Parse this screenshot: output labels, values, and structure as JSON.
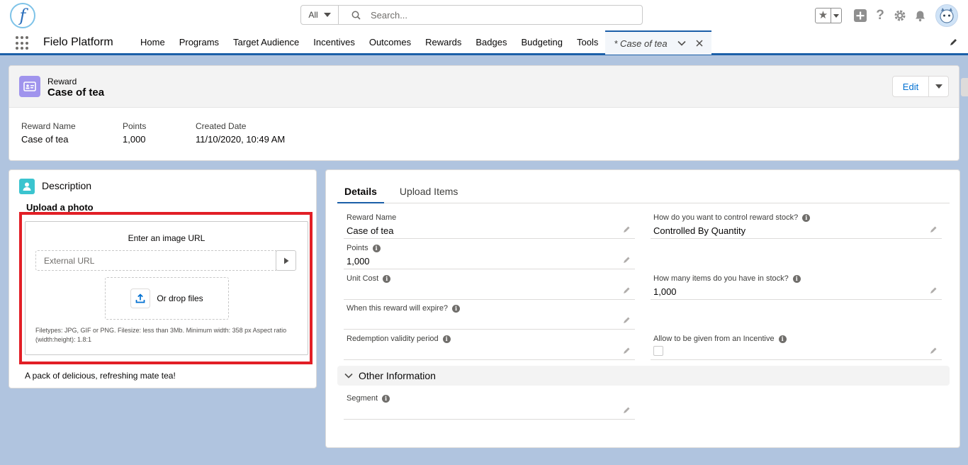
{
  "header": {
    "logo_letter": "f",
    "search_scope": "All",
    "search_placeholder": "Search..."
  },
  "nav": {
    "app_name": "Fielo Platform",
    "items": [
      "Home",
      "Programs",
      "Target Audience",
      "Incentives",
      "Outcomes",
      "Rewards",
      "Badges",
      "Budgeting",
      "Tools"
    ],
    "active_tab": "* Case of tea"
  },
  "record": {
    "type": "Reward",
    "title": "Case of tea",
    "edit_label": "Edit",
    "highlights": [
      {
        "label": "Reward Name",
        "value": "Case of tea"
      },
      {
        "label": "Points",
        "value": "1,000"
      },
      {
        "label": "Created Date",
        "value": "11/10/2020, 10:49 AM"
      }
    ]
  },
  "description_card": {
    "title": "Description",
    "upload_heading": "Upload a photo",
    "url_prompt": "Enter an image URL",
    "url_placeholder": "External URL",
    "drop_label": "Or drop files",
    "hint": "Filetypes: JPG, GIF or PNG. Filesize: less than 3Mb. Minimum width: 358 px Aspect ratio (width:height): 1.8:1",
    "description": "A pack of delicious, refreshing mate tea!"
  },
  "details": {
    "tabs": [
      "Details",
      "Upload Items"
    ],
    "left_fields": [
      {
        "label": "Reward Name",
        "value": "Case of tea",
        "info": false
      },
      {
        "label": "Points",
        "value": "1,000",
        "info": true
      },
      {
        "label": "Unit Cost",
        "value": "",
        "info": true
      },
      {
        "label": "When this reward will expire?",
        "value": "",
        "info": true
      },
      {
        "label": "Redemption validity period",
        "value": "",
        "info": true
      }
    ],
    "right_fields": [
      {
        "label": "How do you want to control reward stock?",
        "value": "Controlled By Quantity",
        "info": true
      },
      {
        "label": "How many items do you have in stock?",
        "value": "1,000",
        "info": true
      },
      {
        "label": "Allow to be given from an Incentive",
        "value": "",
        "info": true
      }
    ],
    "section_title": "Other Information",
    "section_fields": [
      {
        "label": "Segment",
        "value": "",
        "info": true
      }
    ],
    "info_glyph": "i"
  },
  "colors": {
    "brand": "#1b5fa8",
    "reward_icon": "#a094ed",
    "description_icon": "#3bc4cf",
    "highlight": "#e21f26"
  }
}
